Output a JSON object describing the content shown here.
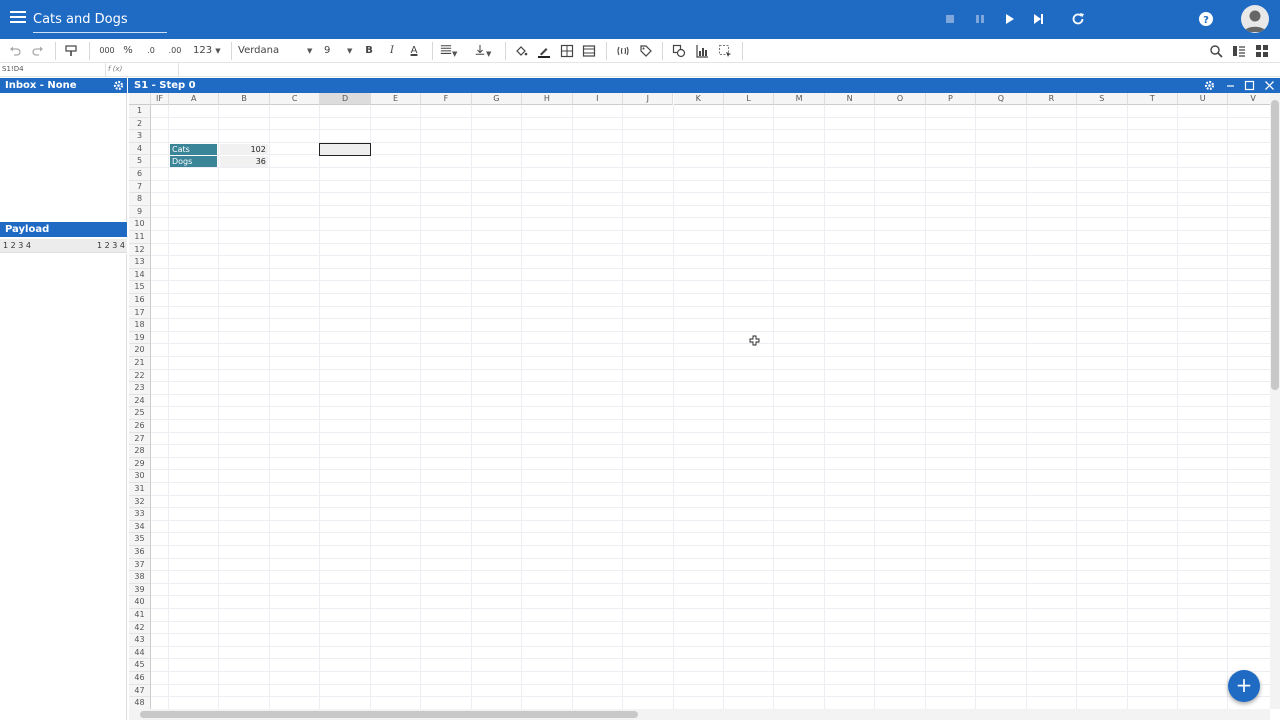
{
  "app": {
    "title": "Cats and Dogs",
    "accent_color": "#1f6bc4"
  },
  "topbar": {
    "controls": [
      "stop-icon",
      "pause-icon",
      "play-icon",
      "step-forward-icon",
      "refresh-icon"
    ],
    "help_icon": "help-icon",
    "avatar_icon": "account-icon"
  },
  "toolbar": {
    "font_family": "Verdana",
    "font_size": "9",
    "number_format": "123",
    "thousands_label": "000",
    "percent_label": "%",
    "dec_dec_label": ".0",
    "dec_inc_label": ".00"
  },
  "formula_bar": {
    "cell_ref": "S1!D4",
    "fx_label": "f (x)"
  },
  "inbox": {
    "title": "Inbox - None"
  },
  "payload": {
    "title": "Payload",
    "left_value": "1 2 3 4",
    "right_value": "1 2 3 4"
  },
  "sheet": {
    "title": "S1 - Step 0",
    "first_col_header": "IF",
    "columns": [
      "A",
      "B",
      "C",
      "D",
      "E",
      "F",
      "G",
      "H",
      "I",
      "J",
      "K",
      "L",
      "M",
      "N",
      "O",
      "P",
      "Q",
      "R",
      "S",
      "T",
      "U",
      "V"
    ],
    "row_count": 48,
    "selected_column": "D",
    "selected_cell": "D4",
    "rows": [
      {
        "row": 4,
        "label": "Cats",
        "value": "102"
      },
      {
        "row": 5,
        "label": "Dogs",
        "value": "36"
      }
    ]
  },
  "fab": {
    "label": "+"
  }
}
